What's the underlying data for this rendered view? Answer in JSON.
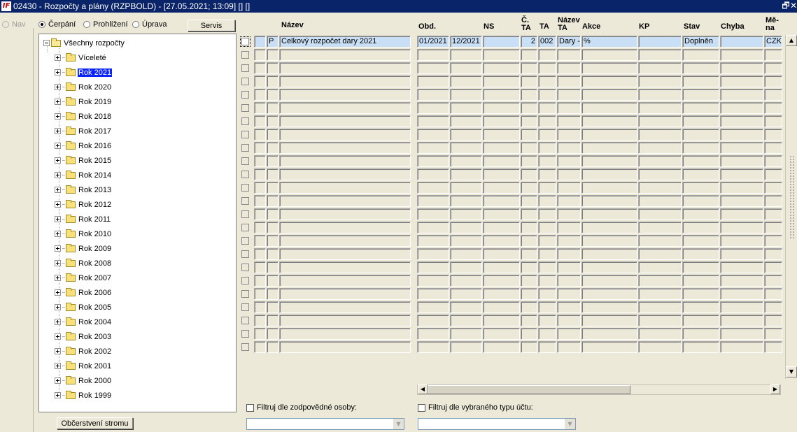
{
  "window": {
    "title": "02430 - Rozpočty a plány (RZPBOLD) - [27.05.2021; 13:09]  []  []",
    "app_icon_text": "IF",
    "restore_glyph": "🗗",
    "close_glyph": "✕"
  },
  "nav": {
    "label": "Nav"
  },
  "mode": {
    "options": [
      {
        "label": "Čerpání",
        "checked": true
      },
      {
        "label": "Prohlížení",
        "checked": false
      },
      {
        "label": "Úprava",
        "checked": false
      }
    ],
    "servis_label": "Servis"
  },
  "tree": {
    "root": "Všechny rozpočty",
    "items": [
      {
        "label": "Víceleté",
        "selected": false
      },
      {
        "label": "Rok 2021",
        "selected": true
      },
      {
        "label": "Rok 2020",
        "selected": false
      },
      {
        "label": "Rok 2019",
        "selected": false
      },
      {
        "label": "Rok 2018",
        "selected": false
      },
      {
        "label": "Rok 2017",
        "selected": false
      },
      {
        "label": "Rok 2016",
        "selected": false
      },
      {
        "label": "Rok 2015",
        "selected": false
      },
      {
        "label": "Rok 2014",
        "selected": false
      },
      {
        "label": "Rok 2013",
        "selected": false
      },
      {
        "label": "Rok 2012",
        "selected": false
      },
      {
        "label": "Rok 2011",
        "selected": false
      },
      {
        "label": "Rok 2010",
        "selected": false
      },
      {
        "label": "Rok 2009",
        "selected": false
      },
      {
        "label": "Rok 2008",
        "selected": false
      },
      {
        "label": "Rok 2007",
        "selected": false
      },
      {
        "label": "Rok 2006",
        "selected": false
      },
      {
        "label": "Rok 2005",
        "selected": false
      },
      {
        "label": "Rok 2004",
        "selected": false
      },
      {
        "label": "Rok 2003",
        "selected": false
      },
      {
        "label": "Rok 2002",
        "selected": false
      },
      {
        "label": "Rok 2001",
        "selected": false
      },
      {
        "label": "Rok 2000",
        "selected": false
      },
      {
        "label": "Rok 1999",
        "selected": false
      }
    ],
    "refresh_label": "Občerstvení stromu"
  },
  "grid": {
    "columns": [
      {
        "key": "flag1",
        "label": ""
      },
      {
        "key": "flag2",
        "label": ""
      },
      {
        "key": "typ",
        "label": ""
      },
      {
        "key": "nazev",
        "label": "Název"
      },
      {
        "key": "obd_od",
        "label": "Obd."
      },
      {
        "key": "obd_do",
        "label": ""
      },
      {
        "key": "ns",
        "label": "NS"
      },
      {
        "key": "c_ta",
        "label": "Č.\nTA"
      },
      {
        "key": "ta",
        "label": "TA"
      },
      {
        "key": "nazev_ta",
        "label": "Název\nTA"
      },
      {
        "key": "akce",
        "label": "Akce"
      },
      {
        "key": "kp",
        "label": "KP"
      },
      {
        "key": "stav",
        "label": "Stav"
      },
      {
        "key": "chyba",
        "label": "Chyba"
      },
      {
        "key": "mena",
        "label": "Mě-\nna"
      }
    ],
    "row_count": 24,
    "rows": [
      {
        "flag1": "",
        "flag2": "",
        "typ": "P",
        "nazev": "Celkový rozpočet dary 2021",
        "obd_od": "01/2021",
        "obd_do": "12/2021",
        "ns": "",
        "c_ta": "2",
        "ta": "002",
        "nazev_ta": "Dary -",
        "akce": "%",
        "kp": "",
        "stav": "Doplněn",
        "chyba": "",
        "mena": "CZK"
      }
    ]
  },
  "filters": {
    "person_label": "Filtruj dle zodpovědné osoby:",
    "person_value": "",
    "account_type_label": "Filtruj dle vybraného typu účtu:",
    "account_type_value": ""
  },
  "icons": {
    "scroll_up": "▲",
    "scroll_down": "▼",
    "scroll_left": "◀",
    "scroll_right": "▶",
    "dropdown": "▼"
  }
}
